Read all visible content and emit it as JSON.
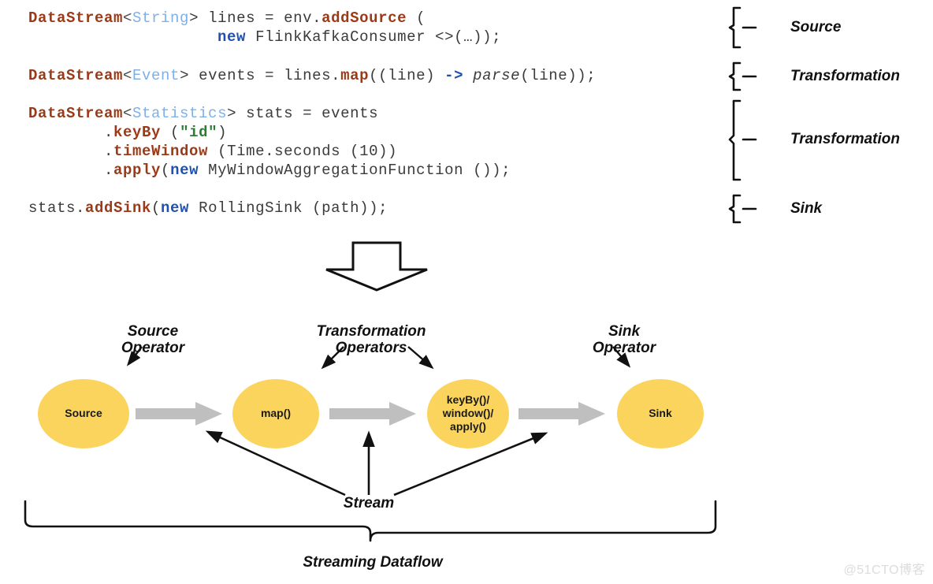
{
  "code": {
    "lines": [
      {
        "id": "line1",
        "tokens": [
          {
            "t": "DataStream",
            "k": "type"
          },
          {
            "t": "<",
            "k": "angle"
          },
          {
            "t": "String",
            "k": "generic"
          },
          {
            "t": "> lines = env.",
            "k": "plain"
          },
          {
            "t": "addSource",
            "k": "method"
          },
          {
            "t": " (",
            "k": "plain"
          }
        ]
      },
      {
        "id": "line2",
        "tokens": [
          {
            "t": "                    ",
            "k": "plain"
          },
          {
            "t": "new",
            "k": "keyword"
          },
          {
            "t": " FlinkKafkaConsumer <>(…));",
            "k": "plain"
          }
        ]
      },
      {
        "id": "line3",
        "tokens": [
          {
            "t": "DataStream",
            "k": "type"
          },
          {
            "t": "<",
            "k": "angle"
          },
          {
            "t": "Event",
            "k": "generic"
          },
          {
            "t": "> events = lines.",
            "k": "plain"
          },
          {
            "t": "map",
            "k": "method"
          },
          {
            "t": "((line) ",
            "k": "plain"
          },
          {
            "t": "->",
            "k": "arrow"
          },
          {
            "t": " ",
            "k": "plain"
          },
          {
            "t": "parse",
            "k": "italic"
          },
          {
            "t": "(line));",
            "k": "plain"
          }
        ]
      },
      {
        "id": "line4",
        "tokens": [
          {
            "t": "DataStream",
            "k": "type"
          },
          {
            "t": "<",
            "k": "angle"
          },
          {
            "t": "Statistics",
            "k": "generic"
          },
          {
            "t": "> stats = events",
            "k": "plain"
          }
        ]
      },
      {
        "id": "line5",
        "tokens": [
          {
            "t": "        .",
            "k": "plain"
          },
          {
            "t": "keyBy",
            "k": "method"
          },
          {
            "t": " (",
            "k": "plain"
          },
          {
            "t": "\"id\"",
            "k": "string"
          },
          {
            "t": ")",
            "k": "plain"
          }
        ]
      },
      {
        "id": "line6",
        "tokens": [
          {
            "t": "        .",
            "k": "plain"
          },
          {
            "t": "timeWindow",
            "k": "method"
          },
          {
            "t": " (Time.seconds (10))",
            "k": "plain"
          }
        ]
      },
      {
        "id": "line7",
        "tokens": [
          {
            "t": "        .",
            "k": "plain"
          },
          {
            "t": "apply",
            "k": "method"
          },
          {
            "t": "(",
            "k": "plain"
          },
          {
            "t": "new",
            "k": "keyword"
          },
          {
            "t": " MyWindowAggregationFunction ());",
            "k": "plain"
          }
        ]
      },
      {
        "id": "line8",
        "tokens": [
          {
            "t": "stats.",
            "k": "plain"
          },
          {
            "t": "addSink",
            "k": "method"
          },
          {
            "t": "(",
            "k": "plain"
          },
          {
            "t": "new",
            "k": "keyword"
          },
          {
            "t": " RollingSink (path));",
            "k": "plain"
          }
        ]
      }
    ]
  },
  "brace_labels": {
    "source": "Source",
    "transformation_1": "Transformation",
    "transformation_2": "Transformation",
    "sink": "Sink"
  },
  "diagram": {
    "operator_labels": {
      "source_operator": "Source\nOperator",
      "transformation_operators": "Transformation\nOperators",
      "sink_operator": "Sink\nOperator"
    },
    "nodes": [
      {
        "id": "source",
        "label": "Source"
      },
      {
        "id": "map",
        "label": "map()"
      },
      {
        "id": "keyby",
        "label": "keyBy()/\nwindow()/\napply()"
      },
      {
        "id": "sink",
        "label": "Sink"
      }
    ],
    "stream_label": "Stream",
    "dataflow_label": "Streaming Dataflow"
  },
  "watermark": "@51CTO博客",
  "colors": {
    "node_fill": "#FBD45E",
    "stream_arrow": "#BFBFBF",
    "type_token": "#9C3A17",
    "generic_token": "#7FB0E8",
    "keyword_token": "#2050B0",
    "string_token": "#2E7D32",
    "line_black": "#111111",
    "background": "#FFFFFF"
  }
}
